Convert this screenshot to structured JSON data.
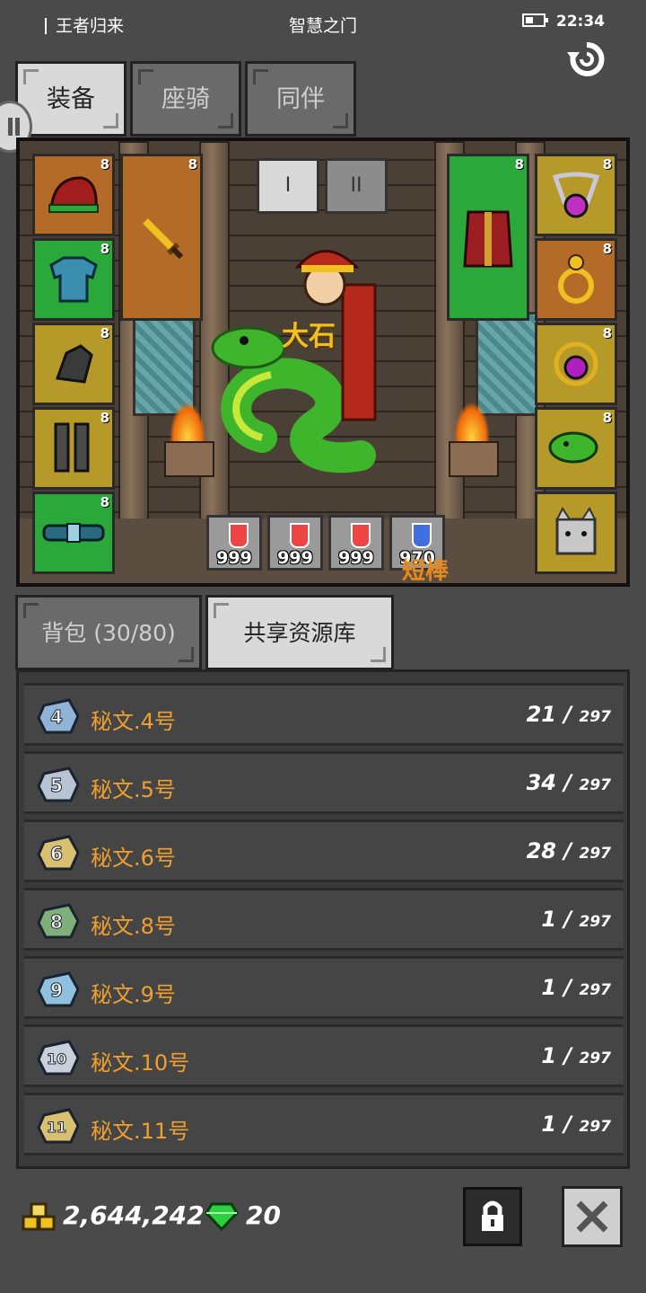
{
  "status_bar": {
    "app_name": "王者归来",
    "title": "智慧之门",
    "time": "22:34"
  },
  "top_tabs": [
    {
      "label": "装备",
      "active": true
    },
    {
      "label": "座骑",
      "active": false
    },
    {
      "label": "同伴",
      "active": false
    }
  ],
  "equipment": {
    "set_buttons": [
      "I",
      "II"
    ],
    "hero_name": "大石",
    "weapon_label": "短棒",
    "left_slots": [
      {
        "icon": "hat-icon",
        "level": "8",
        "color": "orange"
      },
      {
        "icon": "armor-icon",
        "level": "8",
        "color": "green"
      },
      {
        "icon": "gauntlet-icon",
        "level": "8",
        "color": "yellow"
      },
      {
        "icon": "boots-icon",
        "level": "8",
        "color": "yellow"
      },
      {
        "icon": "belt-icon",
        "level": "8",
        "color": "green"
      }
    ],
    "weapon_slot": {
      "icon": "sword-icon",
      "level": "8",
      "color": "orange"
    },
    "offhand_slot": {
      "icon": "cloak-icon",
      "level": "8",
      "color": "green"
    },
    "right_slots": [
      {
        "icon": "necklace-icon",
        "level": "8",
        "color": "yellow"
      },
      {
        "icon": "ring-icon",
        "level": "8",
        "color": "orange"
      },
      {
        "icon": "amulet-icon",
        "level": "8",
        "color": "yellow"
      },
      {
        "icon": "snake-pet-icon",
        "level": "8",
        "color": "yellow"
      },
      {
        "icon": "cat-pet-icon",
        "level": "",
        "color": "yellow"
      }
    ],
    "potions": [
      {
        "count": "999",
        "color": "#e04040"
      },
      {
        "count": "999",
        "color": "#e04040"
      },
      {
        "count": "999",
        "color": "#e04040"
      },
      {
        "count": "970",
        "color": "#4070e0"
      }
    ]
  },
  "bag_tabs": [
    {
      "label": "背包 (30/80)",
      "active": false
    },
    {
      "label": "共享资源库",
      "active": true
    }
  ],
  "items": [
    {
      "name": "秘文.4号",
      "count": "21",
      "max": "297",
      "rune": "4",
      "tint": "#8fb4d8"
    },
    {
      "name": "秘文.5号",
      "count": "34",
      "max": "297",
      "rune": "5",
      "tint": "#b8c4d4"
    },
    {
      "name": "秘文.6号",
      "count": "28",
      "max": "297",
      "rune": "6",
      "tint": "#d8c070"
    },
    {
      "name": "秘文.8号",
      "count": "1",
      "max": "297",
      "rune": "8",
      "tint": "#7fb07a"
    },
    {
      "name": "秘文.9号",
      "count": "1",
      "max": "297",
      "rune": "9",
      "tint": "#8fc0e0"
    },
    {
      "name": "秘文.10号",
      "count": "1",
      "max": "297",
      "rune": "10",
      "tint": "#c8d0dc"
    },
    {
      "name": "秘文.11号",
      "count": "1",
      "max": "297",
      "rune": "11",
      "tint": "#d8c070"
    }
  ],
  "footer": {
    "gold": "2,644,242",
    "gems": "20"
  },
  "colors": {
    "accent_text": "#f0a030",
    "slot_orange": "#b36b27",
    "slot_green": "#2aa83a",
    "slot_yellow": "#b59a2a"
  }
}
